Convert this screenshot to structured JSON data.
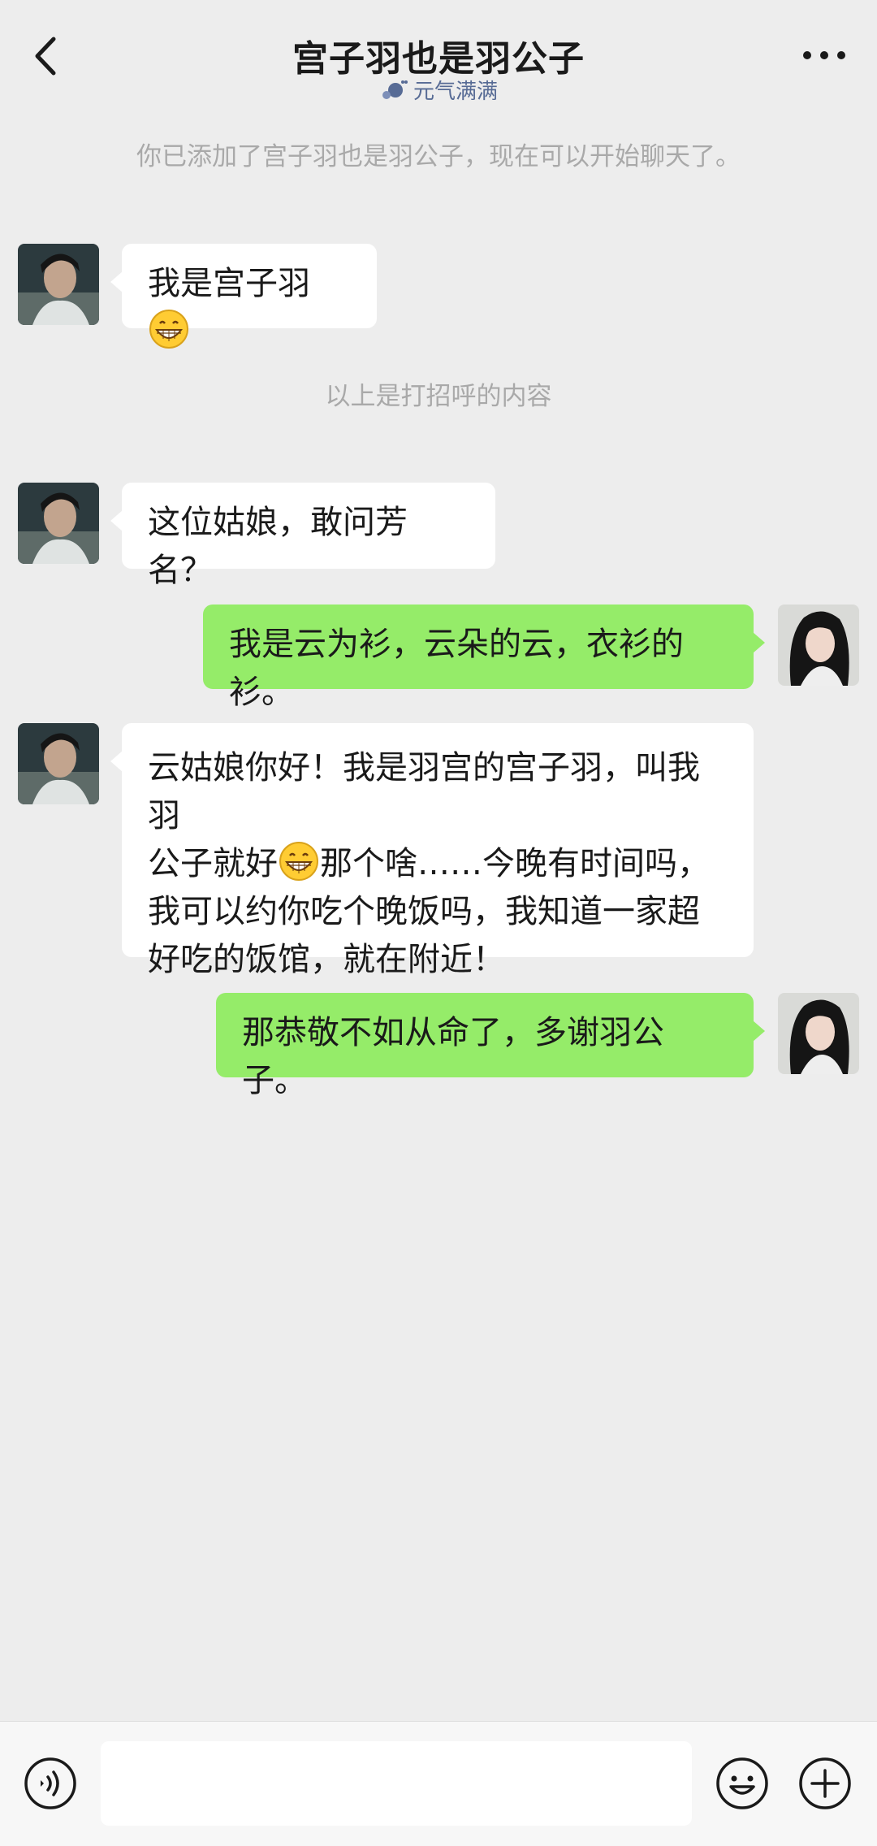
{
  "header": {
    "title": "宫子羽也是羽公子",
    "subtitle": "元气满满",
    "back_icon": "chevron-left-icon",
    "more_icon": "more-dots-icon"
  },
  "system_notes": [
    "你已添加了宫子羽也是羽公子，现在可以开始聊天了。",
    "以上是打招呼的内容"
  ],
  "messages": [
    {
      "from": "contact",
      "text_before_emoji": "我是宫子羽",
      "emoji": "grinning-face-emoji",
      "text_after_emoji": ""
    },
    {
      "from": "contact",
      "text": "这位姑娘，敢问芳名？"
    },
    {
      "from": "me",
      "text": "我是云为衫，云朵的云，衣衫的衫。"
    },
    {
      "from": "contact",
      "lines": [
        "云姑娘你好！我是羽宫的宫子羽，叫我羽",
        "公子就好",
        "那个啥……今晚有时间吗，",
        "我可以约你吃个晚饭吗，我知道一家超",
        "好吃的饭馆，就在附近！"
      ],
      "emoji": "grinning-face-emoji"
    },
    {
      "from": "me",
      "text": "那恭敬不如从命了，多谢羽公子。"
    }
  ],
  "input_bar": {
    "voice_icon": "voice-icon",
    "emoji_icon": "emoji-icon",
    "plus_icon": "plus-icon",
    "input_value": ""
  },
  "colors": {
    "background": "#ededed",
    "incoming_bubble": "#ffffff",
    "outgoing_bubble": "#95ec69",
    "system_text": "#a9a9a9",
    "subtitle_text": "#576b95"
  }
}
